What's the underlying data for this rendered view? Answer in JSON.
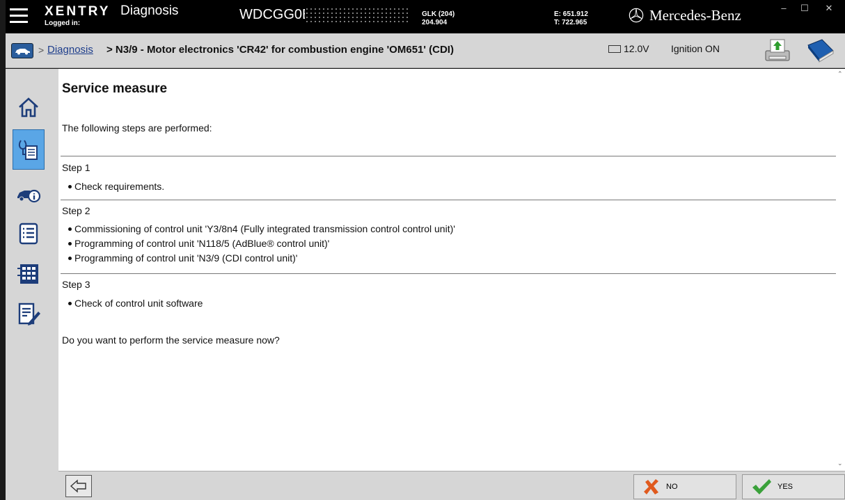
{
  "titlebar": {
    "brand": "XENTRY",
    "product": "Diagnosis",
    "logged_in": "Logged in:",
    "vin": "WDCGG0EE",
    "model_line1": "GLK (204)",
    "model_line2": "204.904",
    "engine_line1": "E: 651.912",
    "engine_line2": "T: 722.965",
    "manufacturer": "Mercedes-Benz",
    "minimize": "–",
    "maximize": "☐",
    "close": "✕"
  },
  "breadcrumb": {
    "separator": ">",
    "link": "Diagnosis",
    "title": "> N3/9 - Motor electronics 'CR42' for combustion engine 'OM651' (CDI)",
    "voltage": "12.0V",
    "ignition": "Ignition ON"
  },
  "sidebar": {
    "items": [
      {
        "icon": "home-icon"
      },
      {
        "icon": "diagnosis-icon",
        "active": true
      },
      {
        "icon": "vehicle-info-icon"
      },
      {
        "icon": "list-icon"
      },
      {
        "icon": "control-units-icon"
      },
      {
        "icon": "notes-icon"
      }
    ]
  },
  "content": {
    "heading": "Service measure",
    "intro": "The following steps are performed:",
    "steps": [
      {
        "label": "Step 1",
        "items": [
          "Check requirements."
        ]
      },
      {
        "label": "Step 2",
        "items": [
          "Commissioning of control unit 'Y3/8n4 (Fully integrated transmission control control unit)'",
          "Programming of control unit 'N118/5 (AdBlue® control unit)'",
          "Programming of control unit 'N3/9 (CDI control unit)'"
        ]
      },
      {
        "label": "Step 3",
        "items": [
          "Check of control unit software"
        ]
      }
    ],
    "question": "Do you want to perform the service measure now?"
  },
  "bottombar": {
    "no_label": "NO",
    "yes_label": "YES"
  },
  "colors": {
    "accent_active": "#5aa6e6",
    "link": "#1d3d8b",
    "yes_check": "#3aa13a",
    "no_cross": "#e05a1e"
  }
}
